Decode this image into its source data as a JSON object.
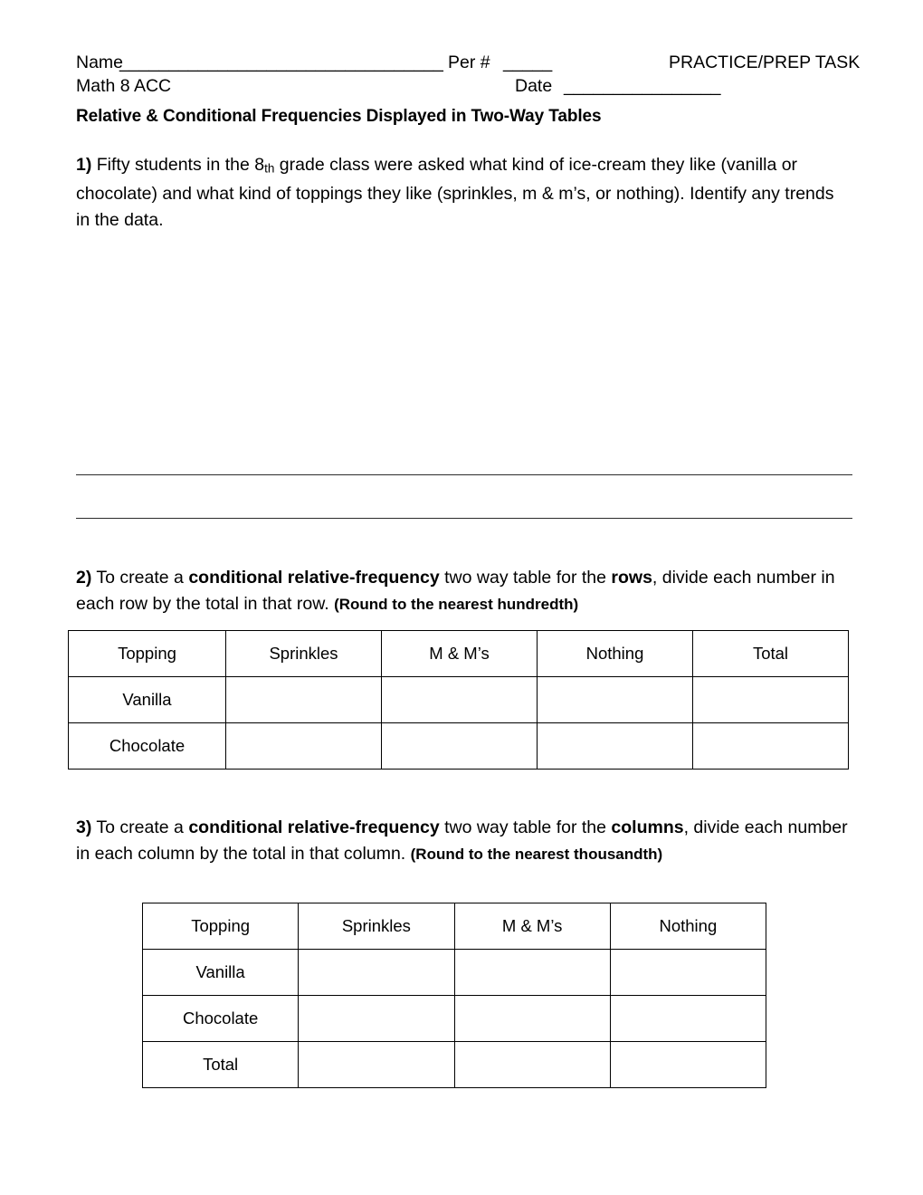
{
  "header": {
    "name_label": "Name",
    "name_blank": "_________________________________",
    "per_label": "Per #",
    "per_blank": "_____",
    "task_label": "PRACTICE/PREP TASK",
    "course_label": "Math 8 ACC",
    "date_label": "Date",
    "date_blank": "________________"
  },
  "title": "Relative & Conditional Frequencies Displayed in Two-Way Tables",
  "questions": {
    "q1": {
      "number": "1)",
      "text_a": " Fifty students in the 8",
      "superscript": "th",
      "text_b": " grade class were asked what kind of ice-cream they like (vanilla or chocolate) and what kind of toppings they like (sprinkles, m & m’s, or nothing). Identify any trends in the data."
    },
    "q2": {
      "number": "2)",
      "text_a": " To create a ",
      "bold_a": "conditional relative-frequency",
      "text_b": " two way table for the ",
      "bold_b": "rows",
      "text_c": ", divide each number in each row by the total in that row. ",
      "note": "(Round to the nearest hundredth)"
    },
    "q3": {
      "number": "3)",
      "text_a": " To create a ",
      "bold_a": "conditional relative-frequency",
      "text_b": " two way table for the ",
      "bold_b": "columns",
      "text_c": ", divide each number in each column by the total in that column. ",
      "note": "(Round to the nearest thousandth)"
    }
  },
  "table_rows": {
    "headers": [
      "Topping",
      "Sprinkles",
      "M & M’s",
      "Nothing",
      "Total"
    ],
    "rows": [
      {
        "label": "Vanilla",
        "cells": [
          "",
          "",
          "",
          ""
        ]
      },
      {
        "label": "Chocolate",
        "cells": [
          "",
          "",
          "",
          ""
        ]
      }
    ]
  },
  "table_cols": {
    "headers": [
      "Topping",
      "Sprinkles",
      "M & M’s",
      "Nothing"
    ],
    "rows": [
      {
        "label": "Vanilla",
        "cells": [
          "",
          "",
          ""
        ]
      },
      {
        "label": "Chocolate",
        "cells": [
          "",
          "",
          ""
        ]
      },
      {
        "label": "Total",
        "cells": [
          "",
          "",
          ""
        ]
      }
    ]
  }
}
